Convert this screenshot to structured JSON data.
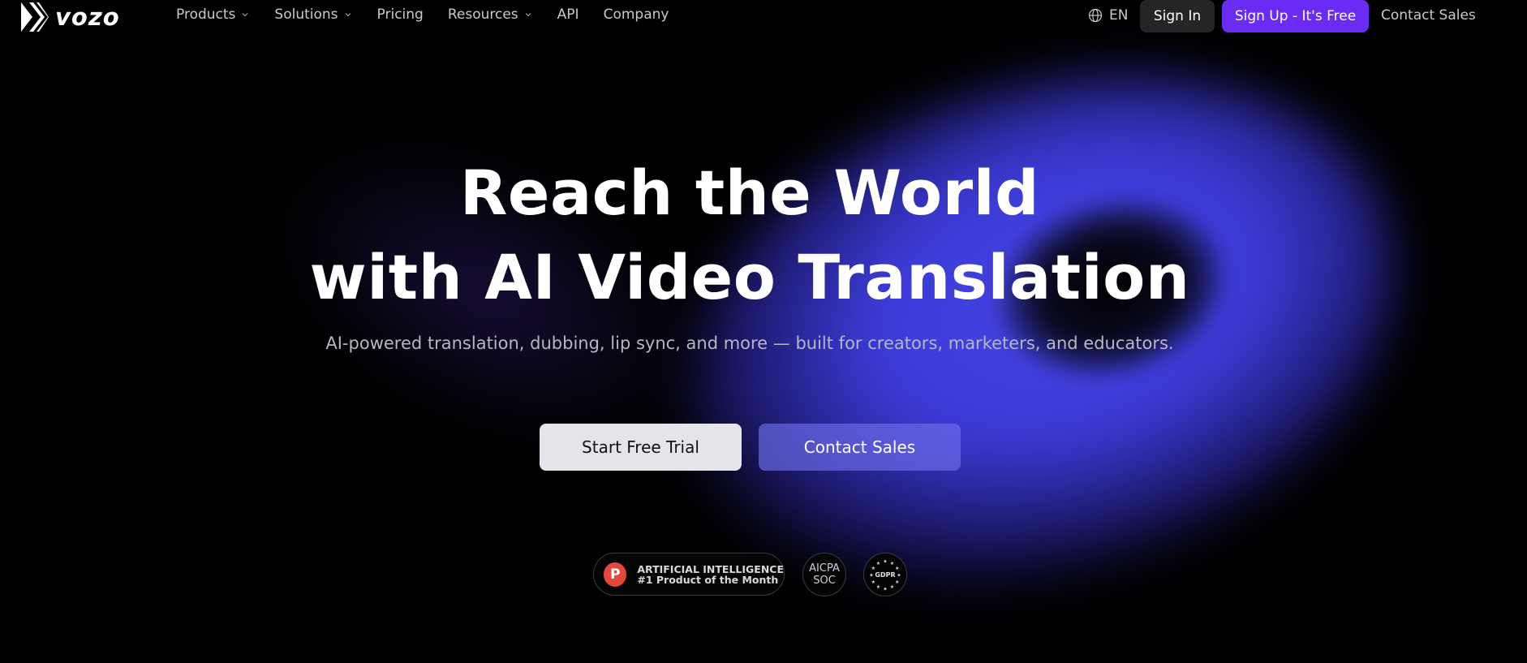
{
  "brand": {
    "name": "vozo"
  },
  "nav": {
    "items": [
      {
        "label": "Products",
        "has_dropdown": true
      },
      {
        "label": "Solutions",
        "has_dropdown": true
      },
      {
        "label": "Pricing",
        "has_dropdown": false
      },
      {
        "label": "Resources",
        "has_dropdown": true
      },
      {
        "label": "API",
        "has_dropdown": false
      },
      {
        "label": "Company",
        "has_dropdown": false
      }
    ],
    "language": "EN",
    "sign_in": "Sign In",
    "sign_up": "Sign Up - It's Free",
    "contact_sales": "Contact Sales"
  },
  "hero": {
    "title_line1": "Reach the World",
    "title_line2": "with AI Video Translation",
    "subtitle": "AI-powered translation, dubbing, lip sync, and more — built for creators, marketers, and educators.",
    "cta_primary": "Start Free Trial",
    "cta_secondary": "Contact Sales"
  },
  "badges": {
    "product_hunt": {
      "letter": "P",
      "line1": "ARTIFICIAL INTELLIGENCE",
      "line2": "#1 Product of the Month"
    },
    "aicpa": {
      "line1": "AICPA",
      "line2": "SOC"
    },
    "gdpr": {
      "label": "GDPR"
    }
  },
  "colors": {
    "accent": "#6a2cf5",
    "background": "#000000",
    "glow": "#4545e6",
    "product_hunt": "#e4483b"
  }
}
